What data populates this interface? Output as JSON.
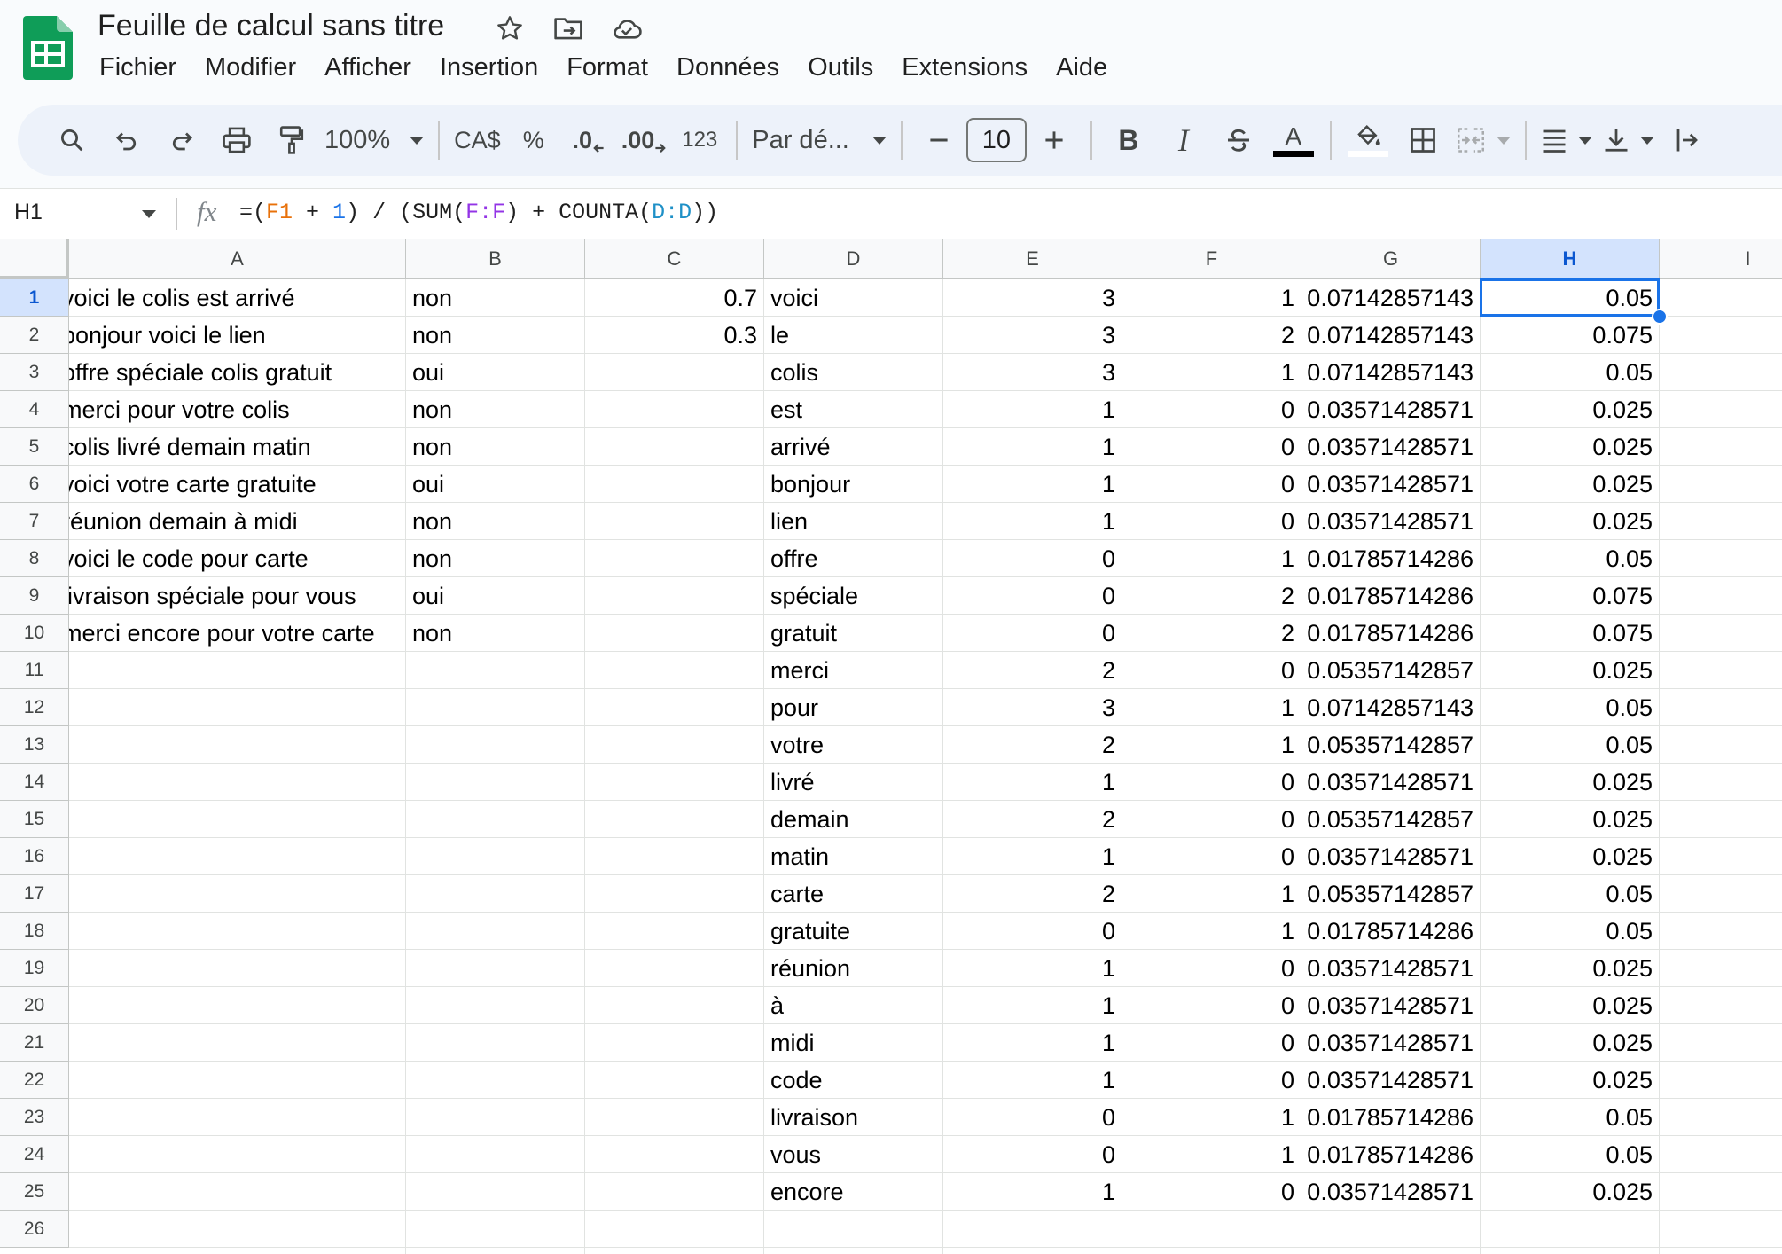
{
  "app": {
    "title": "Feuille de calcul sans titre",
    "brand_color": "#0f9d58",
    "accent_color": "#1a73e8"
  },
  "title_icons": [
    "star-icon",
    "move-to-folder-icon",
    "cloud-status-icon"
  ],
  "menu": [
    "Fichier",
    "Modifier",
    "Afficher",
    "Insertion",
    "Format",
    "Données",
    "Outils",
    "Extensions",
    "Aide"
  ],
  "toolbar": {
    "zoom": "100%",
    "currency": "CA$",
    "percent": "%",
    "decrease_decimals": ".0",
    "increase_decimals": ".00",
    "number_format": "123",
    "font_name": "Par dé...",
    "font_size": "10",
    "bold": "B",
    "italic": "I",
    "text_color_letter": "A"
  },
  "formula_bar": {
    "cell_ref": "H1",
    "fx": "fx",
    "formula_parts": [
      "=(",
      "F1",
      " + ",
      "1",
      ") / (SUM(",
      "F:F",
      ") + COUNTA(",
      "D:D",
      "))"
    ]
  },
  "columns": [
    "A",
    "B",
    "C",
    "D",
    "E",
    "F",
    "G",
    "H",
    "I"
  ],
  "selected": {
    "column": "H",
    "row": 1
  },
  "rows": [
    {
      "n": 1,
      "A": "voici le colis est arrivé",
      "B": "non",
      "C": "0.7",
      "D": "voici",
      "E": "3",
      "F": "1",
      "G": "0.07142857143",
      "H": "0.05"
    },
    {
      "n": 2,
      "A": "bonjour voici le lien",
      "B": "non",
      "C": "0.3",
      "D": "le",
      "E": "3",
      "F": "2",
      "G": "0.07142857143",
      "H": "0.075"
    },
    {
      "n": 3,
      "A": "offre spéciale colis gratuit",
      "B": "oui",
      "C": "",
      "D": "colis",
      "E": "3",
      "F": "1",
      "G": "0.07142857143",
      "H": "0.05"
    },
    {
      "n": 4,
      "A": "merci pour votre colis",
      "B": "non",
      "C": "",
      "D": "est",
      "E": "1",
      "F": "0",
      "G": "0.03571428571",
      "H": "0.025"
    },
    {
      "n": 5,
      "A": "colis livré demain matin",
      "B": "non",
      "C": "",
      "D": "arrivé",
      "E": "1",
      "F": "0",
      "G": "0.03571428571",
      "H": "0.025"
    },
    {
      "n": 6,
      "A": "voici votre carte gratuite",
      "B": "oui",
      "C": "",
      "D": "bonjour",
      "E": "1",
      "F": "0",
      "G": "0.03571428571",
      "H": "0.025"
    },
    {
      "n": 7,
      "A": "réunion demain à midi",
      "B": "non",
      "C": "",
      "D": "lien",
      "E": "1",
      "F": "0",
      "G": "0.03571428571",
      "H": "0.025"
    },
    {
      "n": 8,
      "A": "voici le code pour carte",
      "B": "non",
      "C": "",
      "D": "offre",
      "E": "0",
      "F": "1",
      "G": "0.01785714286",
      "H": "0.05"
    },
    {
      "n": 9,
      "A": "livraison spéciale pour vous",
      "B": "oui",
      "C": "",
      "D": "spéciale",
      "E": "0",
      "F": "2",
      "G": "0.01785714286",
      "H": "0.075"
    },
    {
      "n": 10,
      "A": "merci encore pour votre carte",
      "B": "non",
      "C": "",
      "D": "gratuit",
      "E": "0",
      "F": "2",
      "G": "0.01785714286",
      "H": "0.075"
    },
    {
      "n": 11,
      "A": "",
      "B": "",
      "C": "",
      "D": "merci",
      "E": "2",
      "F": "0",
      "G": "0.05357142857",
      "H": "0.025"
    },
    {
      "n": 12,
      "A": "",
      "B": "",
      "C": "",
      "D": "pour",
      "E": "3",
      "F": "1",
      "G": "0.07142857143",
      "H": "0.05"
    },
    {
      "n": 13,
      "A": "",
      "B": "",
      "C": "",
      "D": "votre",
      "E": "2",
      "F": "1",
      "G": "0.05357142857",
      "H": "0.05"
    },
    {
      "n": 14,
      "A": "",
      "B": "",
      "C": "",
      "D": "livré",
      "E": "1",
      "F": "0",
      "G": "0.03571428571",
      "H": "0.025"
    },
    {
      "n": 15,
      "A": "",
      "B": "",
      "C": "",
      "D": "demain",
      "E": "2",
      "F": "0",
      "G": "0.05357142857",
      "H": "0.025"
    },
    {
      "n": 16,
      "A": "",
      "B": "",
      "C": "",
      "D": "matin",
      "E": "1",
      "F": "0",
      "G": "0.03571428571",
      "H": "0.025"
    },
    {
      "n": 17,
      "A": "",
      "B": "",
      "C": "",
      "D": "carte",
      "E": "2",
      "F": "1",
      "G": "0.05357142857",
      "H": "0.05"
    },
    {
      "n": 18,
      "A": "",
      "B": "",
      "C": "",
      "D": "gratuite",
      "E": "0",
      "F": "1",
      "G": "0.01785714286",
      "H": "0.05"
    },
    {
      "n": 19,
      "A": "",
      "B": "",
      "C": "",
      "D": "réunion",
      "E": "1",
      "F": "0",
      "G": "0.03571428571",
      "H": "0.025"
    },
    {
      "n": 20,
      "A": "",
      "B": "",
      "C": "",
      "D": "à",
      "E": "1",
      "F": "0",
      "G": "0.03571428571",
      "H": "0.025"
    },
    {
      "n": 21,
      "A": "",
      "B": "",
      "C": "",
      "D": "midi",
      "E": "1",
      "F": "0",
      "G": "0.03571428571",
      "H": "0.025"
    },
    {
      "n": 22,
      "A": "",
      "B": "",
      "C": "",
      "D": "code",
      "E": "1",
      "F": "0",
      "G": "0.03571428571",
      "H": "0.025"
    },
    {
      "n": 23,
      "A": "",
      "B": "",
      "C": "",
      "D": "livraison",
      "E": "0",
      "F": "1",
      "G": "0.01785714286",
      "H": "0.05"
    },
    {
      "n": 24,
      "A": "",
      "B": "",
      "C": "",
      "D": "vous",
      "E": "0",
      "F": "1",
      "G": "0.01785714286",
      "H": "0.05"
    },
    {
      "n": 25,
      "A": "",
      "B": "",
      "C": "",
      "D": "encore",
      "E": "1",
      "F": "0",
      "G": "0.03571428571",
      "H": "0.025"
    },
    {
      "n": 26,
      "A": "",
      "B": "",
      "C": "",
      "D": "",
      "E": "",
      "F": "",
      "G": "",
      "H": ""
    }
  ]
}
